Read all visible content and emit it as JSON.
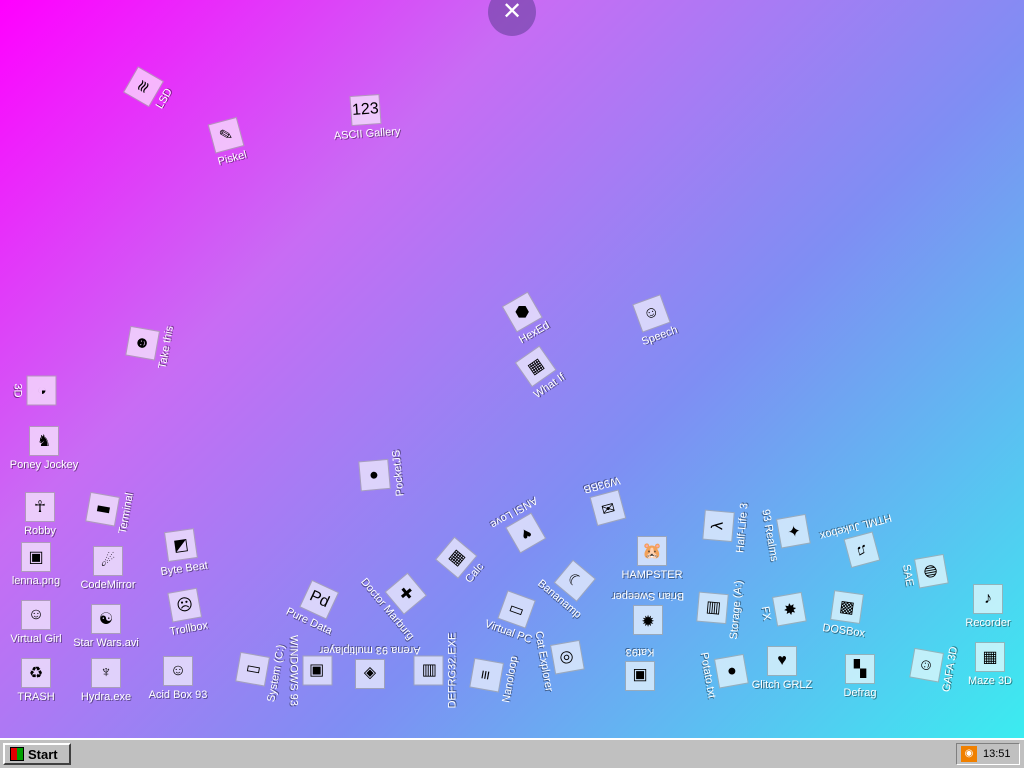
{
  "close_button": {
    "label": "✕"
  },
  "desktop_icons": [
    {
      "label": "LSD",
      "glyph": "≋"
    },
    {
      "label": "ASCII Gallery",
      "glyph": "123"
    },
    {
      "label": "Piskel",
      "glyph": "✎"
    },
    {
      "label": "HexEd",
      "glyph": "⬢"
    },
    {
      "label": "Speech",
      "glyph": "☺"
    },
    {
      "label": "Take this",
      "glyph": "☻"
    },
    {
      "label": "What If",
      "glyph": "▦"
    },
    {
      "label": "3D",
      "glyph": "◔"
    },
    {
      "label": "Poney Jockey",
      "glyph": "♞"
    },
    {
      "label": "PocketJS",
      "glyph": "●"
    },
    {
      "label": "W93BB",
      "glyph": "✉"
    },
    {
      "label": "Robby",
      "glyph": "☥"
    },
    {
      "label": "Terminal",
      "glyph": "▮"
    },
    {
      "label": "ANSI Love",
      "glyph": "♥"
    },
    {
      "label": "Half-Life 3",
      "glyph": "λ"
    },
    {
      "label": "93 Realms",
      "glyph": "✦"
    },
    {
      "label": "HTML Jukebox",
      "glyph": "♫"
    },
    {
      "label": "lenna.png",
      "glyph": "▣"
    },
    {
      "label": "CodeMirror",
      "glyph": "☄"
    },
    {
      "label": "Byte Beat",
      "glyph": "◩"
    },
    {
      "label": "Calc",
      "glyph": "▦"
    },
    {
      "label": "HAMPSTER",
      "glyph": "🐹"
    },
    {
      "label": "Bananamp",
      "glyph": "☾"
    },
    {
      "label": "SAE",
      "glyph": "◍"
    },
    {
      "label": "Pure Data",
      "glyph": "Pd"
    },
    {
      "label": "Doctor Marburg",
      "glyph": "✚"
    },
    {
      "label": "Brian Sweeper",
      "glyph": "✹"
    },
    {
      "label": "Storage (A:)",
      "glyph": "▤"
    },
    {
      "label": "FX",
      "glyph": "✸"
    },
    {
      "label": "DOSBox",
      "glyph": "▩"
    },
    {
      "label": "Recorder",
      "glyph": "♪"
    },
    {
      "label": "Virtual Girl",
      "glyph": "☺"
    },
    {
      "label": "Star Wars.avi",
      "glyph": "☯"
    },
    {
      "label": "Trollbox",
      "glyph": "☹"
    },
    {
      "label": "Virtual PC",
      "glyph": "▭"
    },
    {
      "label": "Cat Explorer",
      "glyph": "◎"
    },
    {
      "label": "Arena 93 multiplayer",
      "glyph": "◈"
    },
    {
      "label": "DEFRG32.EXE",
      "glyph": "▤"
    },
    {
      "label": "Nanoloop",
      "glyph": "≡"
    },
    {
      "label": "Kat93",
      "glyph": "▣"
    },
    {
      "label": "Potato.txt",
      "glyph": "●"
    },
    {
      "label": "Glitch GRLZ",
      "glyph": "♥"
    },
    {
      "label": "Defrag",
      "glyph": "▚"
    },
    {
      "label": "GAFA 3D",
      "glyph": "☺"
    },
    {
      "label": "Maze 3D",
      "glyph": "▦"
    },
    {
      "label": "TRASH",
      "glyph": "♻"
    },
    {
      "label": "Hydra.exe",
      "glyph": "♆"
    },
    {
      "label": "Acid Box 93",
      "glyph": "☺"
    },
    {
      "label": "System (C:)",
      "glyph": "▯"
    },
    {
      "label": "WINDOWS 93",
      "glyph": "▣"
    }
  ],
  "taskbar": {
    "start_label": "Start",
    "clock": "13:51"
  }
}
